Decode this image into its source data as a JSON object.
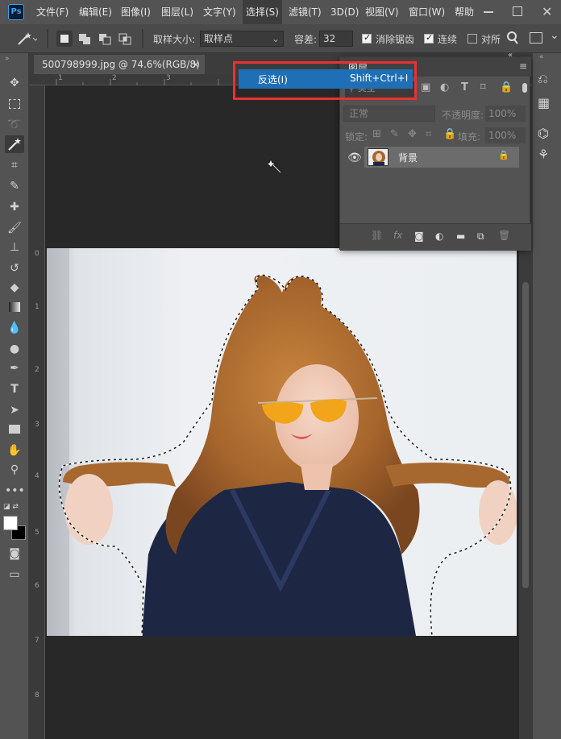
{
  "app": {
    "logo": "Ps"
  },
  "menubar": {
    "items": [
      "文件(F)",
      "编辑(E)",
      "图像(I)",
      "图层(L)",
      "文字(Y)",
      "选择(S)",
      "滤镜(T)",
      "3D(D)",
      "视图(V)",
      "窗口(W)",
      "帮助"
    ],
    "active": "选择(S)"
  },
  "options": {
    "sample_size_label": "取样大小:",
    "sample_size_value": "取样点",
    "tolerance_label": "容差:",
    "tolerance_value": "32",
    "antialias_label": "消除锯齿",
    "antialias_checked": true,
    "contiguous_label": "连续",
    "contiguous_checked": true,
    "all_layers_label": "对所",
    "all_layers_checked": false
  },
  "document": {
    "tab_title": "500798999.jpg @ 74.6%(RGB/8) *",
    "close_glyph": "×",
    "h_ruler_ticks": [
      "1",
      "2",
      "3"
    ],
    "v_ruler_ticks": [
      "0",
      "1",
      "2",
      "3",
      "4",
      "5",
      "6",
      "7",
      "8"
    ]
  },
  "context_menu": {
    "item_label": "反选(I)",
    "item_shortcut": "Shift+Ctrl+I"
  },
  "layers_panel": {
    "title": "图层",
    "filter_label": "类型",
    "blend_mode": "正常",
    "opacity_label": "不透明度:",
    "opacity_value": "100%",
    "lock_label": "锁定:",
    "fill_label": "填充:",
    "fill_value": "100%",
    "layer_name": "背景"
  },
  "colors": {
    "accent": "#1f6fb6",
    "highlight_box": "#e63232",
    "panel": "#535353",
    "canvas": "#282828"
  },
  "icons": [
    "magic-wand-icon",
    "move-icon",
    "marquee-icon",
    "lasso-icon",
    "crop-icon",
    "eyedropper-icon",
    "healing-icon",
    "brush-icon",
    "stamp-icon",
    "history-brush-icon",
    "eraser-icon",
    "gradient-icon",
    "blur-icon",
    "dodge-icon",
    "pen-icon",
    "type-icon",
    "path-select-icon",
    "rectangle-icon",
    "hand-icon",
    "zoom-icon",
    "more-icon",
    "eye-icon",
    "lock-icon",
    "link-icon",
    "fx-icon",
    "mask-icon",
    "adjustment-icon",
    "folder-icon",
    "new-layer-icon",
    "trash-icon",
    "search-icon"
  ]
}
